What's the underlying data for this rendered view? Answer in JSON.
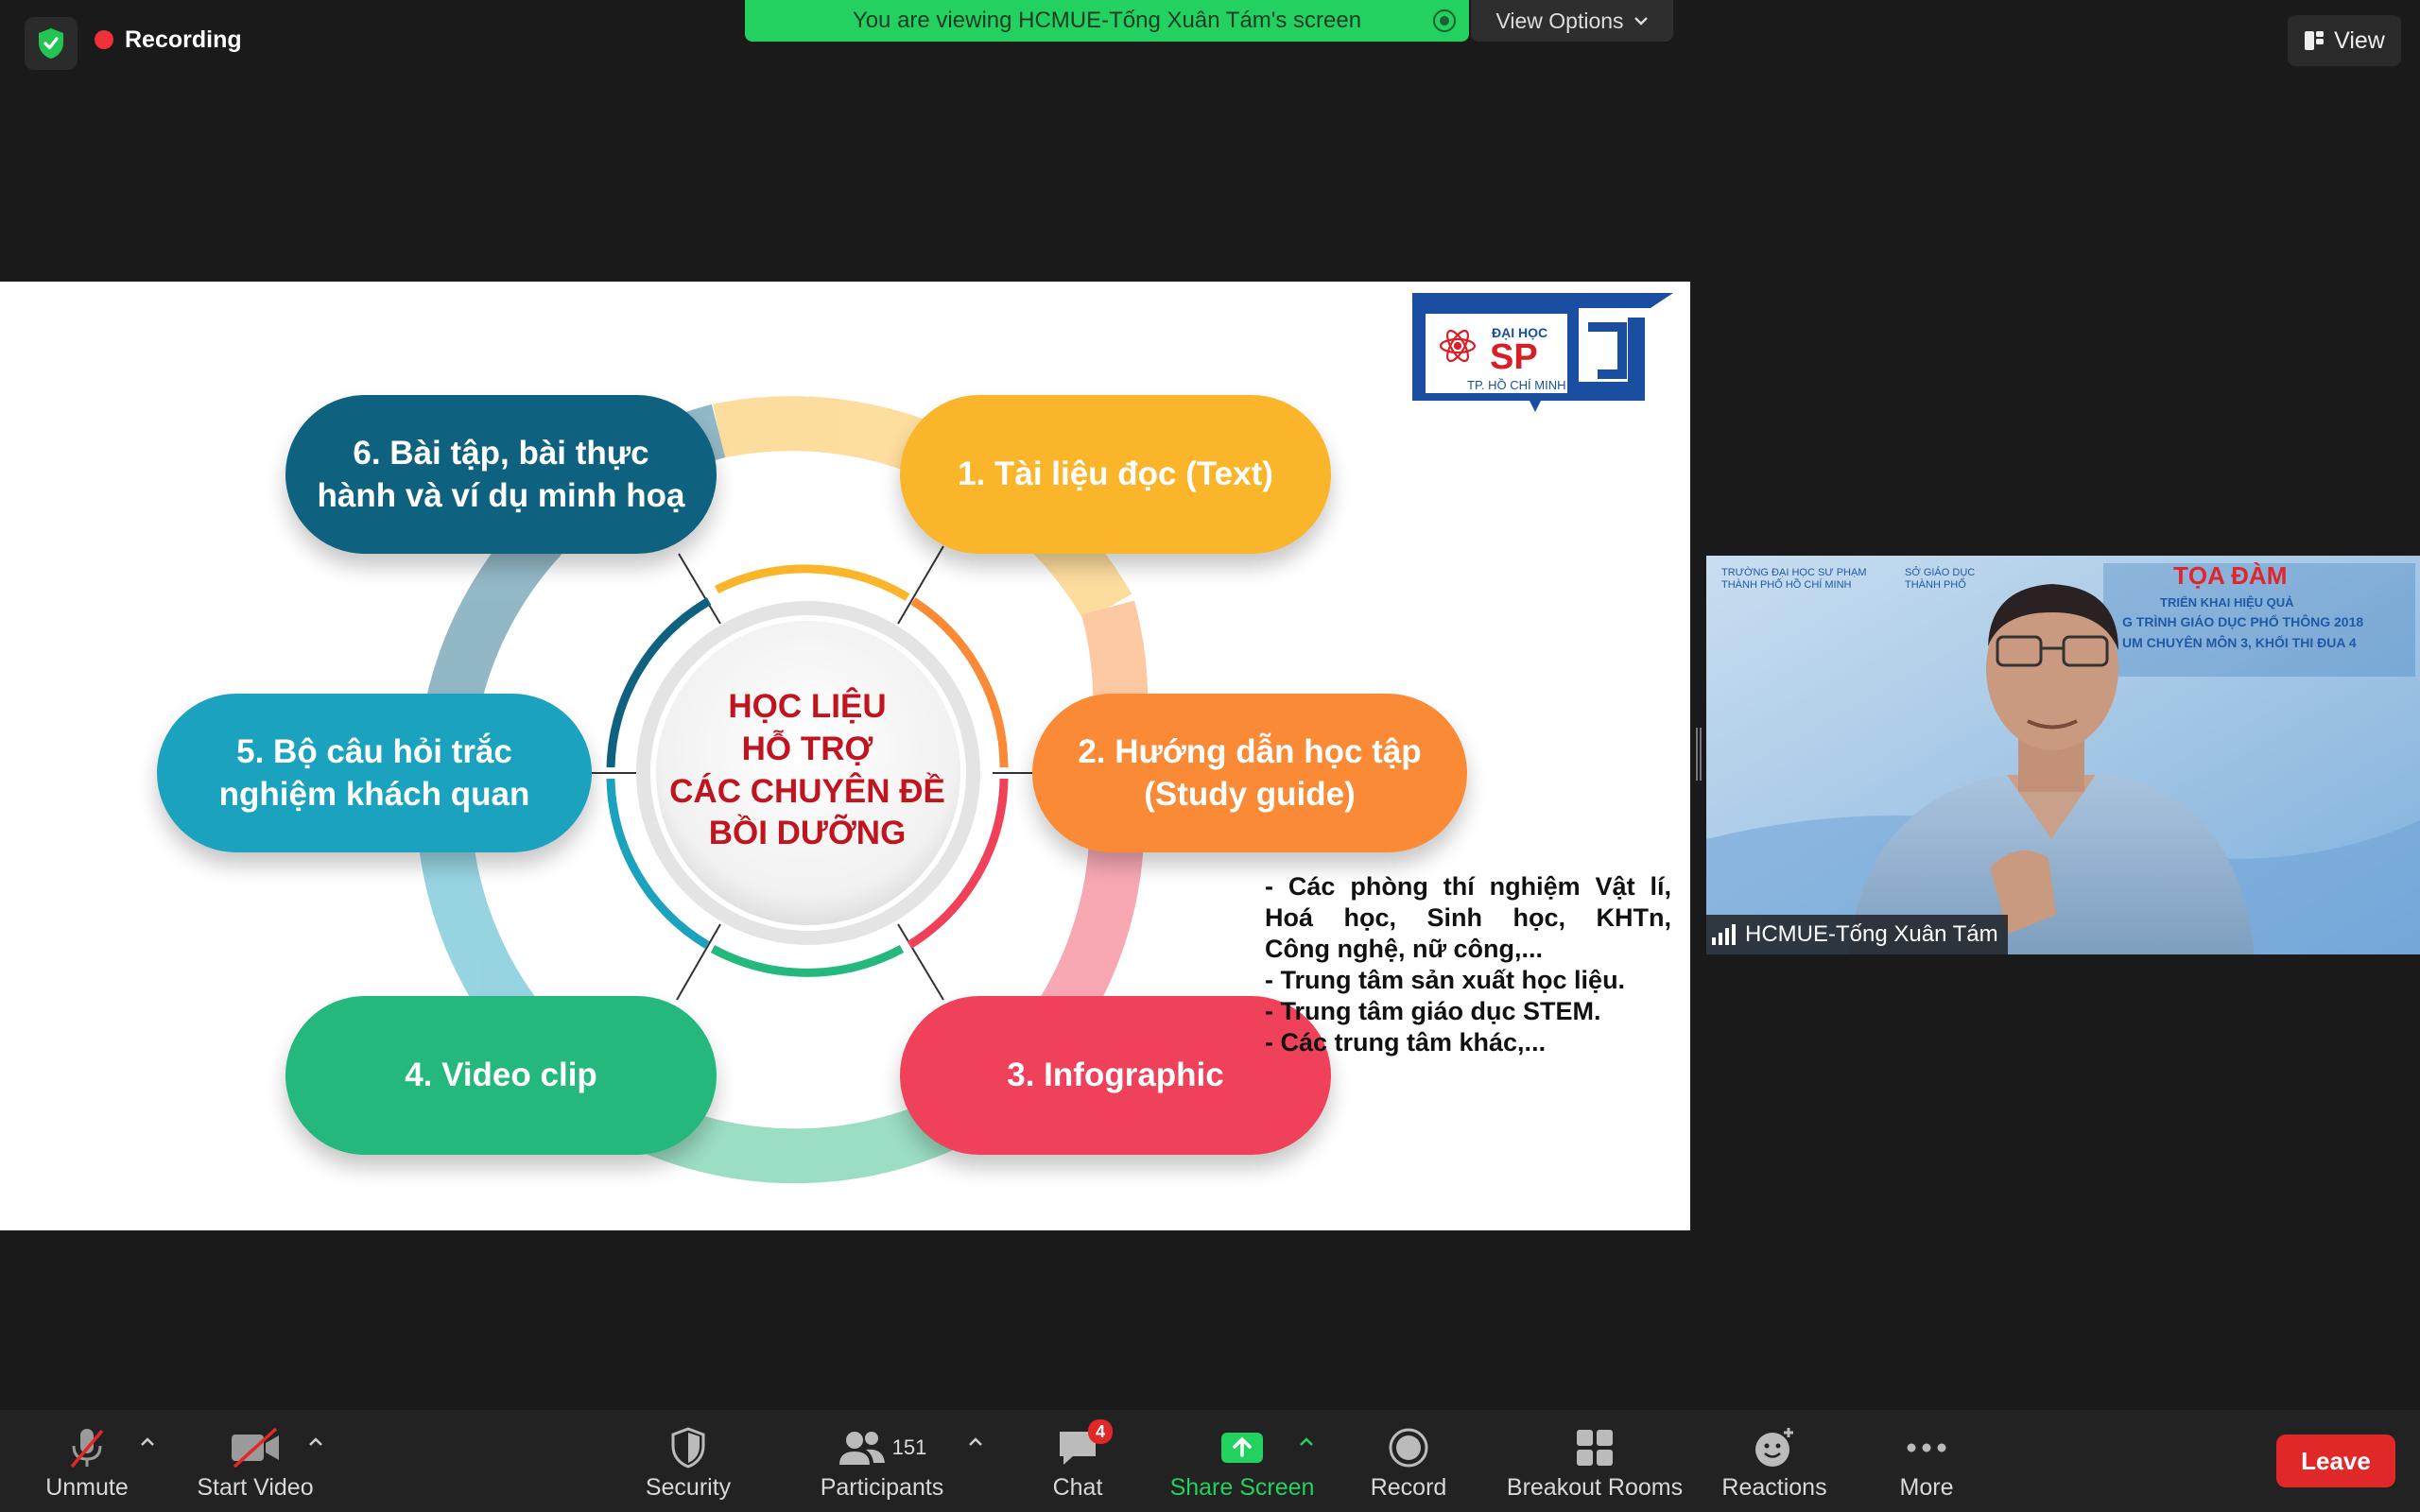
{
  "top": {
    "recording_label": "Recording",
    "viewing_banner": "You are viewing HCMUE-Tống Xuân Tám's screen",
    "view_options_label": "View Options",
    "view_label": "View"
  },
  "slide": {
    "center_title": "HỌC LIỆU\nHỖ TRỢ\nCÁC CHUYÊN ĐỀ\nBỒI DƯỠNG",
    "items": [
      {
        "label": "1. Tài liệu đọc (Text)",
        "color": "#fbb52a"
      },
      {
        "label": "2. Hướng dẫn học tập\n(Study guide)",
        "color": "#fb8a36"
      },
      {
        "label": "3. Infographic",
        "color": "#ef4159"
      },
      {
        "label": "4. Video clip",
        "color": "#24b87d"
      },
      {
        "label": "5. Bộ câu hỏi trắc\nnghiệm khách quan",
        "color": "#1ba2bf"
      },
      {
        "label": "6. Bài tập, bài thực\nhành và ví dụ minh hoạ",
        "color": "#0f6180"
      }
    ],
    "notes": [
      "- Các phòng thí nghiệm Vật lí,",
      "Hoá học, Sinh học, KHTn,",
      "Công nghệ, nữ công,...",
      "- Trung tâm sản xuất học liệu.",
      "- Trung tâm giáo dục STEM.",
      "- Các trung tâm khác,..."
    ],
    "logo": {
      "top": "ĐẠI HỌC",
      "main": "SP",
      "bottom": "TP. HỒ CHÍ MINH"
    }
  },
  "video": {
    "participant_name": "HCMUE-Tống Xuân Tám",
    "backdrop_title": "TỌA ĐÀM",
    "backdrop_line1": "TRIỂN KHAI HIỆU QUẢ",
    "backdrop_line2": "G TRÌNH GIÁO DỤC PHỔ THÔNG 2018",
    "backdrop_line3": "UM CHUYÊN MÔN 3, KHỐI THI ĐUA 4",
    "backdrop_org1": "TRƯỜNG ĐẠI HỌC SƯ PHẠM\nTHÀNH PHỐ HỒ CHÍ MINH",
    "backdrop_org2": "SỞ GIÁO DỤC\nTHÀNH PHỐ"
  },
  "toolbar": {
    "unmute": "Unmute",
    "start_video": "Start Video",
    "security": "Security",
    "participants": "Participants",
    "participants_count": "151",
    "chat": "Chat",
    "chat_badge": "4",
    "share_screen": "Share Screen",
    "record": "Record",
    "breakout_rooms": "Breakout Rooms",
    "reactions": "Reactions",
    "more": "More",
    "leave": "Leave"
  },
  "colors": {
    "banner_green": "#23d160",
    "leave_red": "#e02828",
    "share_green": "#23d160",
    "center_text_red": "#c0151f"
  }
}
